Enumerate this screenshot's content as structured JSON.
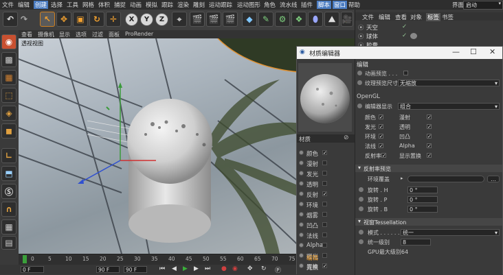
{
  "menu": {
    "items": [
      "文件",
      "编辑",
      "创建",
      "选择",
      "工具",
      "网格",
      "体积",
      "捕捉",
      "动画",
      "模拟",
      "跟踪",
      "渲染",
      "雕刻",
      "运动跟踪",
      "运动图形",
      "角色",
      "流水线",
      "插件",
      "脚本",
      "窗口",
      "帮助"
    ],
    "highlighted": [
      "创建",
      "选择",
      "工具",
      "网格",
      "体积",
      "运动跟踪",
      "角色",
      "插件",
      "脚本",
      "窗口"
    ],
    "interface_label": "界面:",
    "interface_value": "启动"
  },
  "toolbar": {
    "x": "X",
    "y": "Y",
    "z": "Z"
  },
  "viewport": {
    "menu": [
      "查看",
      "摄像机",
      "显示",
      "选项",
      "过滤",
      "面板",
      "ProRender"
    ],
    "label": "透视视图"
  },
  "timeline": {
    "ticks": [
      "0",
      "5",
      "10",
      "15",
      "20",
      "25",
      "30",
      "35",
      "40",
      "45",
      "50",
      "55",
      "60",
      "65",
      "70",
      "75",
      "80",
      "85",
      "90"
    ],
    "start": "0 F",
    "fields": [
      "0 F",
      "90 F",
      "90 F"
    ]
  },
  "object_manager": {
    "tabs": [
      "文件",
      "编辑",
      "查看",
      "对象",
      "标签",
      "书签"
    ],
    "active_tab": "标签",
    "objects": [
      "天空",
      "球体",
      "胶囊"
    ]
  },
  "material_editor": {
    "title": "材质编辑器",
    "material_name": "材质",
    "channels": [
      {
        "label": "颜色",
        "checked": true
      },
      {
        "label": "漫射",
        "checked": false
      },
      {
        "label": "发光",
        "checked": false
      },
      {
        "label": "透明",
        "checked": false
      },
      {
        "label": "反射",
        "checked": true
      },
      {
        "label": "环境",
        "checked": false
      },
      {
        "label": "烟雾",
        "checked": false
      },
      {
        "label": "凹凸",
        "checked": false
      },
      {
        "label": "法线",
        "checked": false
      },
      {
        "label": "Alpha",
        "checked": false
      },
      {
        "label": "辉光",
        "checked": false
      },
      {
        "label": "置换",
        "checked": true
      }
    ],
    "bottom_items": [
      "编辑",
      "光照"
    ],
    "right": {
      "section_edit": "编辑",
      "anim_preview": "动画预览 . . .",
      "tex_preview_label": "纹理预览尺寸",
      "tex_preview_value": "无缩放",
      "opengl": "OpenGL",
      "editor_display_label": "编辑器显示",
      "editor_display_value": "组合",
      "opts_left": [
        "颜色",
        "发光",
        "环境",
        "法线",
        "反射率"
      ],
      "opts_right": [
        "漫射",
        "透明",
        "凹凸",
        "Alpha",
        "显示置换"
      ],
      "reflect_section": "反射率预览",
      "env_cover_label": "环境覆盖",
      "rotate_h": "旋转 . H",
      "rotate_p": "旋转 . P",
      "rotate_b": "旋转 . B",
      "rot_value": "0 °",
      "tess_section": "视窗Tessellation",
      "mode_label": "模式 . . . . . . .",
      "mode_value": "统一",
      "level_label": "统一级别",
      "level_value": "8",
      "gpu_note": "GPU最大级别64"
    }
  },
  "colors": {
    "accent": "#f0a030",
    "selection": "#4b7cc1"
  }
}
